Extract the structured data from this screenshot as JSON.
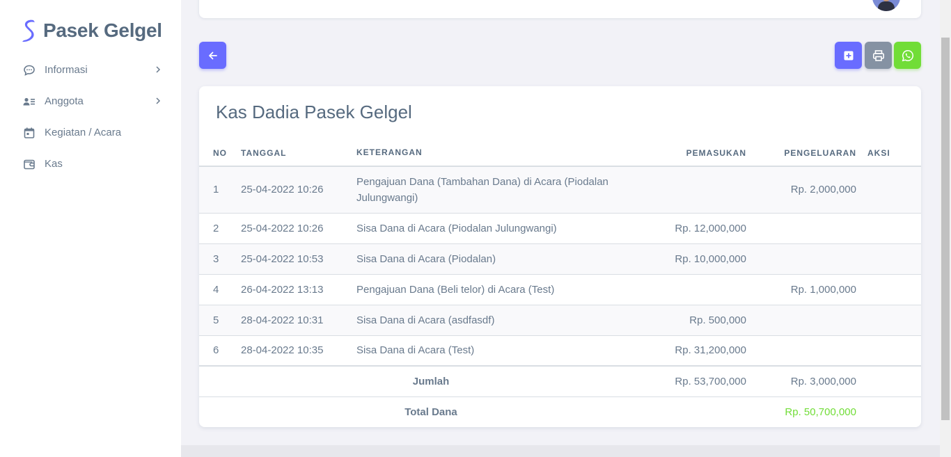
{
  "brand": {
    "name": "Pasek Gelgel",
    "accent": "#696cff"
  },
  "sidebar": {
    "items": [
      {
        "label": "Informasi",
        "icon": "chat-bubble-icon",
        "has_submenu": true
      },
      {
        "label": "Anggota",
        "icon": "user-list-icon",
        "has_submenu": true
      },
      {
        "label": "Kegiatan / Acara",
        "icon": "calendar-icon",
        "has_submenu": false
      },
      {
        "label": "Kas",
        "icon": "wallet-icon",
        "has_submenu": false
      }
    ]
  },
  "toolbar": {
    "back_icon": "arrow-left-icon",
    "add_icon": "plus-square-icon",
    "print_icon": "printer-icon",
    "whatsapp_icon": "whatsapp-icon",
    "colors": {
      "primary": "#696cff",
      "secondary": "#8592a3",
      "success": "#71dd37"
    }
  },
  "card": {
    "title": "Kas Dadia Pasek Gelgel",
    "columns": [
      "NO",
      "TANGGAL",
      "KETERANGAN",
      "PEMASUKAN",
      "PENGELUARAN",
      "AKSI"
    ],
    "rows": [
      {
        "no": "1",
        "tanggal": "25-04-2022 10:26",
        "keterangan": "Pengajuan Dana (Tambahan Dana) di Acara (Piodalan Julungwangi)",
        "pemasukan": "",
        "pengeluaran": "Rp. 2,000,000"
      },
      {
        "no": "2",
        "tanggal": "25-04-2022 10:26",
        "keterangan": "Sisa Dana di Acara (Piodalan Julungwangi)",
        "pemasukan": "Rp. 12,000,000",
        "pengeluaran": ""
      },
      {
        "no": "3",
        "tanggal": "25-04-2022 10:53",
        "keterangan": "Sisa Dana di Acara (Piodalan)",
        "pemasukan": "Rp. 10,000,000",
        "pengeluaran": ""
      },
      {
        "no": "4",
        "tanggal": "26-04-2022 13:13",
        "keterangan": "Pengajuan Dana (Beli telor) di Acara (Test)",
        "pemasukan": "",
        "pengeluaran": "Rp. 1,000,000"
      },
      {
        "no": "5",
        "tanggal": "28-04-2022 10:31",
        "keterangan": "Sisa Dana di Acara (asdfasdf)",
        "pemasukan": "Rp. 500,000",
        "pengeluaran": ""
      },
      {
        "no": "6",
        "tanggal": "28-04-2022 10:35",
        "keterangan": "Sisa Dana di Acara (Test)",
        "pemasukan": "Rp. 31,200,000",
        "pengeluaran": ""
      }
    ],
    "jumlah": {
      "label": "Jumlah",
      "pemasukan": "Rp. 53,700,000",
      "pengeluaran": "Rp. 3,000,000"
    },
    "total": {
      "label": "Total Dana",
      "value": "Rp. 50,700,000",
      "color": "#71dd37"
    }
  }
}
